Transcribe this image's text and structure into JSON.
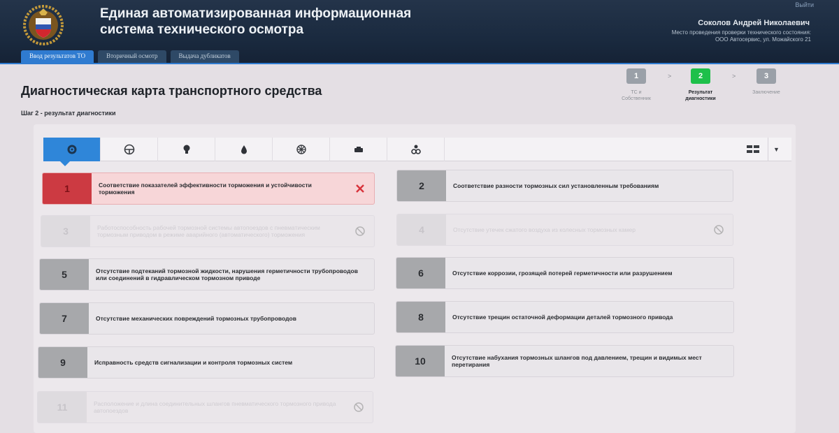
{
  "header": {
    "title_line1": "Единая автоматизированная информационная",
    "title_line2": "система технического осмотра",
    "logout": "Выйти",
    "user_name": "Соколов Андрей Николаевич",
    "location_label": "Место проведения проверки технического состояния:",
    "location_value": "ООО Автосервис, ул. Можайского 21",
    "emblem_icon": "emblem-shield-icon",
    "tabs": [
      {
        "label": "Ввод результатов ТО",
        "active": true
      },
      {
        "label": "Вторичный осмотр",
        "active": false
      },
      {
        "label": "Выдача дубликатов",
        "active": false
      }
    ]
  },
  "page": {
    "title": "Диагностическая карта транспортного средства",
    "step_label": "Шаг 2 - результат диагностики"
  },
  "stepper": [
    {
      "number": "1",
      "label_line1": "ТС и",
      "label_line2": "Собственник",
      "state": "done"
    },
    {
      "number": "2",
      "label_line1": "Результат",
      "label_line2": "диагностики",
      "state": "current"
    },
    {
      "number": "3",
      "label_line1": "Заключение",
      "label_line2": "",
      "state": "pending"
    }
  ],
  "toolbar": {
    "categories": [
      {
        "icon": "brake-disc-icon",
        "active": true
      },
      {
        "icon": "steering-wheel-icon",
        "active": false
      },
      {
        "icon": "light-bulb-icon",
        "active": false
      },
      {
        "icon": "drop-icon",
        "active": false
      },
      {
        "icon": "wheel-icon",
        "active": false
      },
      {
        "icon": "engine-icon",
        "active": false
      },
      {
        "icon": "other-parts-icon",
        "active": false
      }
    ],
    "view_icon": "grid-view-icon",
    "dropdown_icon": "chevron-down-icon"
  },
  "colors": {
    "header_bg": "#1f3046",
    "accent": "#2f7bd0",
    "fail": "#cc3a42",
    "current_step": "#1ec04a"
  },
  "checks": [
    {
      "number": "1",
      "text": "Соответствие показателей эффективности торможения и устойчивости торможения",
      "state": "fail",
      "mark_icon": "close-x-icon"
    },
    {
      "number": "2",
      "text": "Соответствие разности тормозных сил установленным требованиям",
      "state": "normal",
      "mark_icon": ""
    },
    {
      "number": "3",
      "text": "Работоспособность рабочей тормозной системы автопоездов с пневматическим тормозным приводом в режиме аварийного (автоматического) торможения",
      "state": "disabled",
      "mark_icon": "not-applicable-icon"
    },
    {
      "number": "4",
      "text": "Отсутствие утечек сжатого воздуха из колесных тормозных камер",
      "state": "disabled",
      "mark_icon": "not-applicable-icon"
    },
    {
      "number": "5",
      "text": "Отсутствие подтеканий тормозной жидкости, нарушения герметичности трубопроводов или соединений в гидравлическом тормозном приводе",
      "state": "normal",
      "mark_icon": ""
    },
    {
      "number": "6",
      "text": "Отсутствие коррозии, грозящей потерей герметичности или разрушением",
      "state": "normal",
      "mark_icon": ""
    },
    {
      "number": "7",
      "text": "Отсутствие механических повреждений тормозных трубопроводов",
      "state": "normal",
      "mark_icon": ""
    },
    {
      "number": "8",
      "text": "Отсутствие трещин остаточной деформации деталей тормозного привода",
      "state": "normal",
      "mark_icon": ""
    },
    {
      "number": "9",
      "text": "Исправность средств сигнализации и контроля тормозных систем",
      "state": "normal",
      "mark_icon": ""
    },
    {
      "number": "10",
      "text": "Отсутствие набухания тормозных шлангов под давлением, трещин и видимых мест перетирания",
      "state": "normal",
      "mark_icon": ""
    },
    {
      "number": "11",
      "text": "Расположение и длина соединительных шлангов пневматического тормозного привода автопоездов",
      "state": "disabled",
      "mark_icon": "not-applicable-icon"
    }
  ]
}
